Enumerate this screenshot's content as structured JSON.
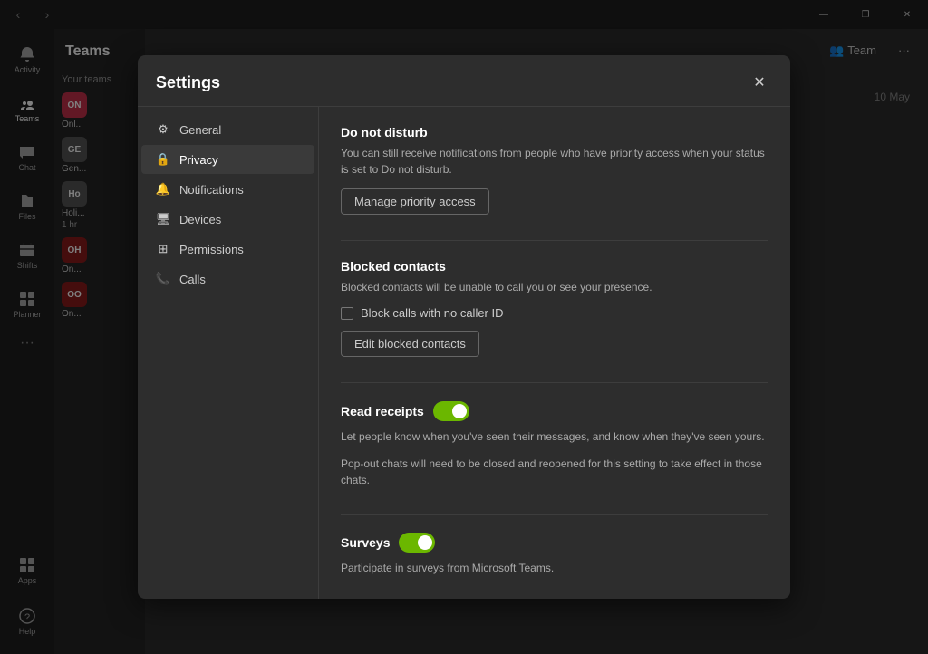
{
  "titleBar": {
    "prevLabel": "‹",
    "nextLabel": "›",
    "controls": {
      "minimize": "—",
      "maximize": "❐",
      "close": "✕"
    }
  },
  "sidebar": {
    "items": [
      {
        "id": "activity",
        "label": "Activity",
        "icon": "bell"
      },
      {
        "id": "teams",
        "label": "Teams",
        "icon": "teams",
        "active": true
      },
      {
        "id": "chat",
        "label": "Chat",
        "icon": "chat"
      },
      {
        "id": "files",
        "label": "Files",
        "icon": "files"
      },
      {
        "id": "shifts",
        "label": "Shifts",
        "icon": "shifts"
      },
      {
        "id": "planner",
        "label": "Planner",
        "icon": "planner"
      }
    ],
    "bottom": [
      {
        "id": "apps",
        "label": "Apps",
        "icon": "apps"
      },
      {
        "id": "help",
        "label": "Help",
        "icon": "help"
      }
    ],
    "more": "..."
  },
  "teamsPanel": {
    "title": "Teams",
    "items": [
      {
        "id": "your-teams",
        "label": "Your teams"
      },
      {
        "id": "team1",
        "badge": "ON",
        "badgeColor": "red",
        "name": "Onl..."
      },
      {
        "id": "team2",
        "badge": "GE",
        "name": "Gen..."
      },
      {
        "id": "team3",
        "badge": "Ho",
        "name": "Holi...",
        "sub": "1 hr"
      },
      {
        "id": "team4",
        "badge": "OH",
        "badgeColor": "dark-red",
        "name": "On..."
      },
      {
        "id": "team5",
        "badge": "OO",
        "badgeColor": "dark-red",
        "name": "On..."
      }
    ]
  },
  "contentHeader": {
    "teamBtn": "Team",
    "moreIcon": "···"
  },
  "modal": {
    "title": "Settings",
    "closeIcon": "✕",
    "nav": [
      {
        "id": "general",
        "label": "General",
        "icon": "⚙"
      },
      {
        "id": "privacy",
        "label": "Privacy",
        "icon": "🔒",
        "active": true
      },
      {
        "id": "notifications",
        "label": "Notifications",
        "icon": "🔔"
      },
      {
        "id": "devices",
        "label": "Devices",
        "icon": "🖥"
      },
      {
        "id": "permissions",
        "label": "Permissions",
        "icon": "⊞"
      },
      {
        "id": "calls",
        "label": "Calls",
        "icon": "📞"
      }
    ],
    "content": {
      "sections": [
        {
          "id": "do-not-disturb",
          "title": "Do not disturb",
          "description": "You can still receive notifications from people who have priority access when your status is set to Do not disturb.",
          "button": "Manage priority access"
        },
        {
          "id": "blocked-contacts",
          "title": "Blocked contacts",
          "description": "Blocked contacts will be unable to call you or see your presence.",
          "checkbox": "Block calls with no caller ID",
          "button": "Edit blocked contacts"
        },
        {
          "id": "read-receipts",
          "title": "Read receipts",
          "toggle": true,
          "description1": "Let people know when you've seen their messages, and know when they've seen yours.",
          "description2": "Pop-out chats will need to be closed and reopened for this setting to take effect in those chats."
        },
        {
          "id": "surveys",
          "title": "Surveys",
          "toggle": true,
          "description1": "Participate in surveys from Microsoft Teams."
        }
      ]
    }
  }
}
